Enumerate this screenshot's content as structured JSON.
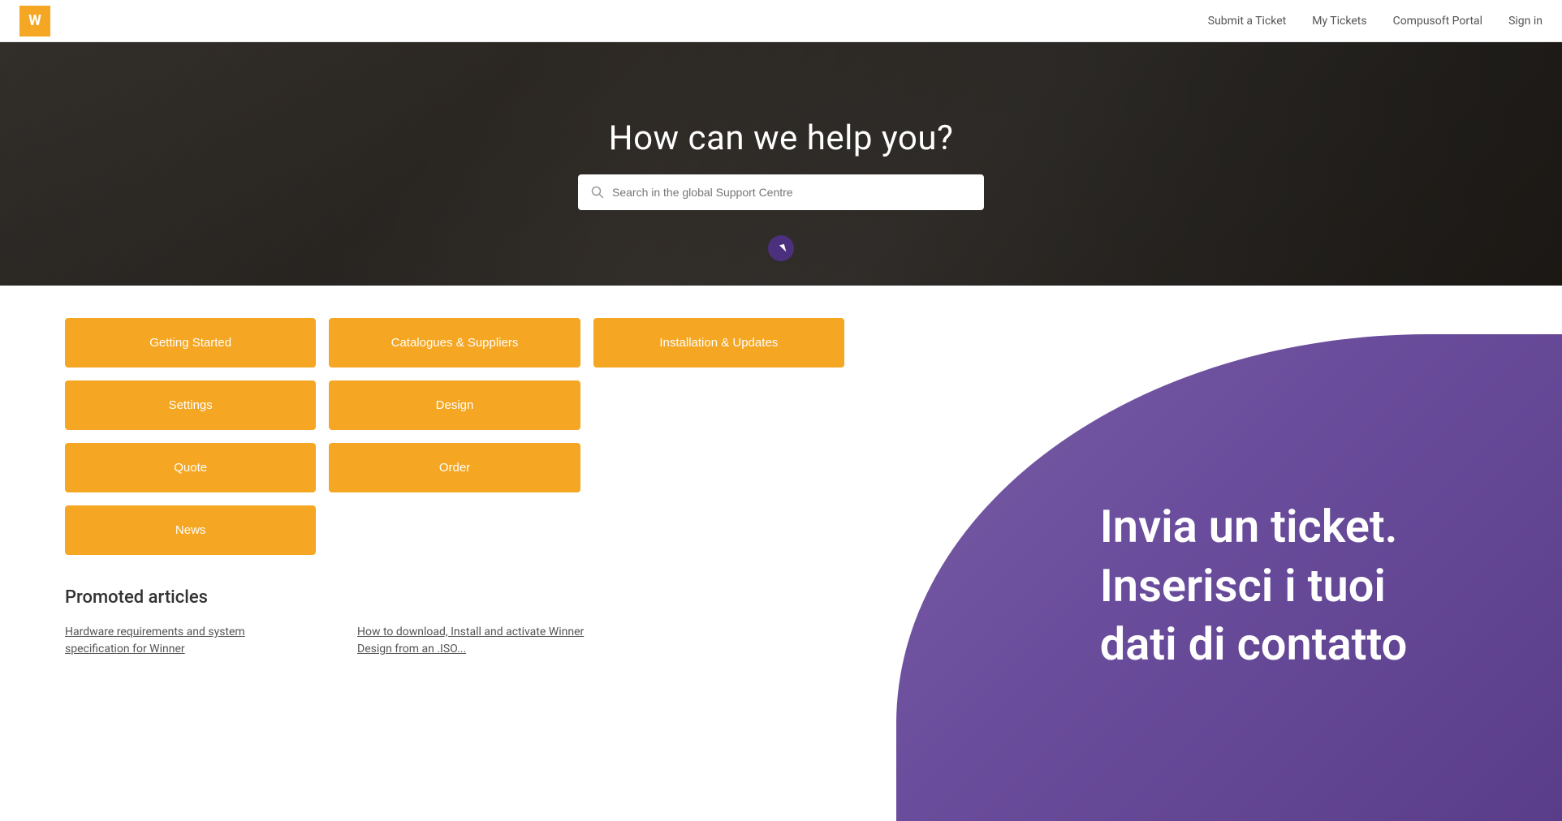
{
  "header": {
    "logo_letter": "W",
    "nav": [
      {
        "label": "Submit a Ticket",
        "id": "submit-ticket"
      },
      {
        "label": "My Tickets",
        "id": "my-tickets"
      },
      {
        "label": "Compusoft Portal",
        "id": "compusoft-portal"
      },
      {
        "label": "Sign in",
        "id": "sign-in"
      }
    ]
  },
  "hero": {
    "title": "How can we help you?",
    "search_placeholder": "Search in the global Support Centre"
  },
  "categories": {
    "buttons": [
      {
        "label": "Getting Started",
        "id": "getting-started"
      },
      {
        "label": "Catalogues & Suppliers",
        "id": "catalogues-suppliers"
      },
      {
        "label": "Installation & Updates",
        "id": "installation-updates"
      },
      {
        "label": "Settings",
        "id": "settings"
      },
      {
        "label": "Design",
        "id": "design"
      },
      {
        "label": "",
        "id": "partial-1"
      },
      {
        "label": "Quote",
        "id": "quote"
      },
      {
        "label": "Order",
        "id": "order"
      },
      {
        "label": "",
        "id": "partial-2"
      },
      {
        "label": "News",
        "id": "news"
      }
    ]
  },
  "promoted": {
    "section_title": "Promoted articles",
    "articles": [
      {
        "text": "Hardware requirements and system specification for Winner",
        "id": "article-hardware"
      },
      {
        "text": "How to download, Install and activate Winner Design from an .ISO...",
        "id": "article-download"
      }
    ]
  },
  "overlay": {
    "line1": "Invia un ticket.",
    "line2": "Inserisci i tuoi",
    "line3": "dati di contatto"
  }
}
